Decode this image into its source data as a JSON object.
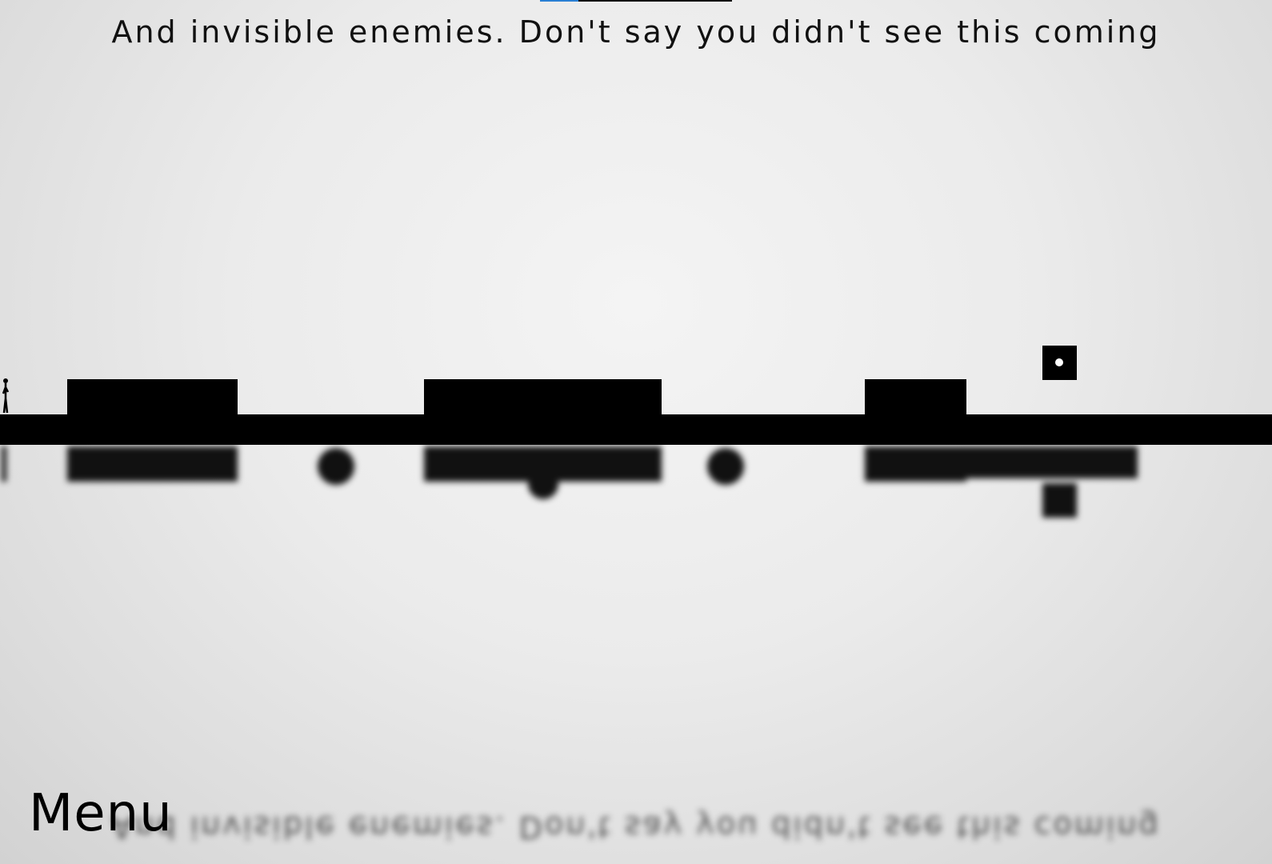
{
  "hint_text": "And invisible enemies. Don't say you didn't see this coming",
  "menu_label": "Menu",
  "level_progress": 0.2,
  "colors": {
    "ink": "#000000",
    "progress_fill": "#2a7fd4",
    "background": "#ebebeb"
  },
  "icons": {
    "player": "stick-figure-icon",
    "coin": "dot-coin-icon"
  }
}
